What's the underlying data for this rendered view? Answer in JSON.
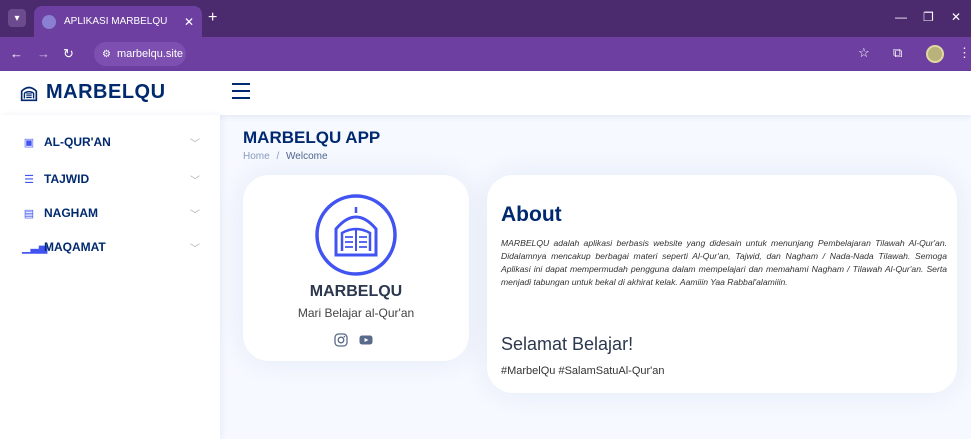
{
  "browser": {
    "tab_title": "APLIKASI MARBELQU",
    "url": "marbelqu.site"
  },
  "app": {
    "logo_text": "MARBELQU"
  },
  "sidebar": {
    "items": [
      {
        "label": "AL-QUR'AN",
        "icon": "book-icon"
      },
      {
        "label": "TAJWID",
        "icon": "document-icon"
      },
      {
        "label": "NAGHAM",
        "icon": "list-icon"
      },
      {
        "label": "MAQAMAT",
        "icon": "bar-chart-icon"
      }
    ]
  },
  "main": {
    "page_title": "MARBELQU APP",
    "breadcrumb": [
      "Home",
      "Welcome"
    ]
  },
  "profile_card": {
    "name": "MARBELQU",
    "subtitle": "Mari Belajar al-Qur'an",
    "social": [
      "instagram-icon",
      "youtube-icon"
    ]
  },
  "about": {
    "title": "About",
    "text": "MARBELQU adalah aplikasi berbasis website yang didesain untuk menunjang Pembelajaran Tilawah Al-Qur'an. Didalamnya mencakup berbagai materi seperti Al-Qur'an, Tajwid, dan Nagham / Nada-Nada Tilawah. Semoga Aplikasi ini dapat mempermudah pengguna dalam mempelajari dan memahami Nagham / Tilawah Al-Qur'an. Serta menjadi tabungan untuk bekal di akhirat kelak. Aamiiin Yaa Rabbal'alamiiin.",
    "greeting": "Selamat Belajar!",
    "hashtags": "#MarbelQu #SalamSatuAl-Qur'an"
  },
  "colors": {
    "primary": "#4154f1",
    "heading": "#012970",
    "chrome": "#6c3fa0"
  }
}
